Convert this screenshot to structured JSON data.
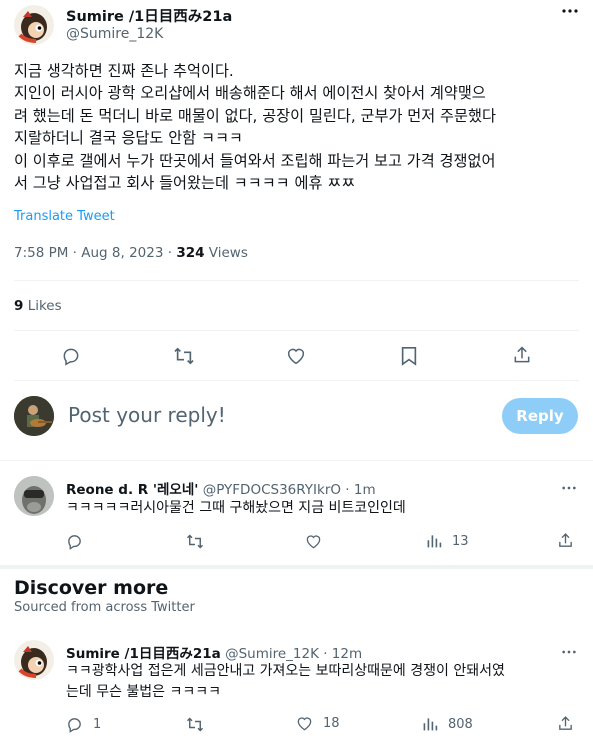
{
  "main_tweet": {
    "author_name": "Sumire /1日目西み21a",
    "author_handle": "@Sumire_12K",
    "text_lines": [
      "지금 생각하면 진짜 존나 추억이다.",
      "지인이 러시아 광학 오리샵에서 배송해준다 해서 에이전시 찾아서 계약맺으",
      "려 했는데 돈 먹더니 바로 매물이 없다, 공장이 밀린다, 군부가 먼저 주문했다",
      "지랄하더니 결국 응답도 안함 ㅋㅋㅋ",
      "이 이후로 갤에서 누가 딴곳에서 들여와서 조립해 파는거 보고 가격 경쟁없어",
      "서 그냥 사업접고 회사 들어왔는데 ㅋㅋㅋㅋ 에휴 ㅉㅉ"
    ],
    "translate_label": "Translate Tweet",
    "timestamp": "7:58 PM · Aug 8, 2023 · ",
    "views_count": "324",
    "views_label": " Views",
    "likes_count": "9",
    "likes_label": " Likes"
  },
  "reply_composer": {
    "placeholder": "Post your reply!",
    "button_label": "Reply"
  },
  "reply": {
    "author_name": "Reone d. R '레오네'",
    "author_handle": "@PYFDOCS36RYIkrO",
    "time": " · 1m",
    "text": "ㅋㅋㅋㅋㅋ러시아물건 그때 구해놨으면 지금 비트코인인데",
    "views": "13"
  },
  "discover": {
    "title": "Discover more",
    "subtitle": "Sourced from across Twitter"
  },
  "discover_tweet": {
    "author_name": "Sumire /1日目西み21a",
    "author_handle": "@Sumire_12K",
    "time": " · 12m",
    "text_lines": [
      "ㅋㅋ광학사업 접은게 세금안내고 가져오는 보따리상때문에 경쟁이 안돼서였",
      "는데 무슨 불법은 ㅋㅋㅋㅋ"
    ],
    "replies": "1",
    "likes": "18",
    "views": "808"
  },
  "colors": {
    "accent": "#1d9bf0",
    "reply_button_disabled": "#8ecdf8",
    "muted_text": "#536471"
  }
}
